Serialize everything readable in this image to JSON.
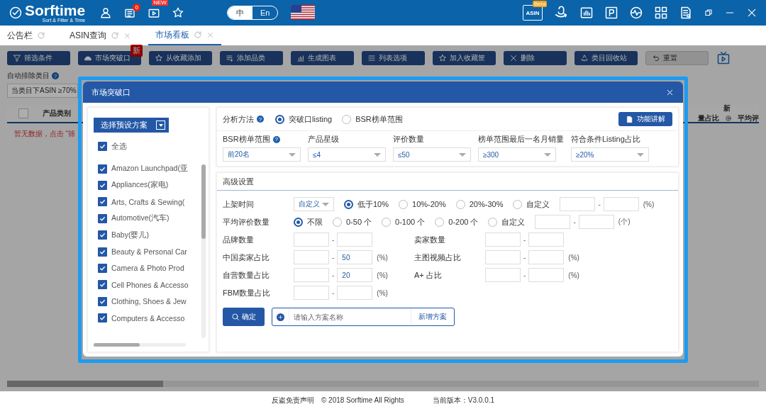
{
  "app": {
    "logo": "Sorftime",
    "tagline": "Sort & Filter & Time",
    "notice_count": "0",
    "video_badge": "NEW",
    "languages": [
      {
        "label": "中",
        "selected": true
      },
      {
        "label": "En",
        "selected": false
      }
    ],
    "asin_badge": "Beta",
    "asin_label": "ASIN"
  },
  "tabs": [
    {
      "label": "公告栏",
      "selected": false,
      "closable": false
    },
    {
      "label": "ASIN查询",
      "selected": false,
      "closable": true
    },
    {
      "label": "市场看板",
      "selected": true,
      "closable": true
    }
  ],
  "toolbar": [
    {
      "label": "筛选条件",
      "kind": "filter"
    },
    {
      "label": "市场突破口",
      "kind": "rocket",
      "badge": "新"
    },
    {
      "label": "从收藏添加",
      "kind": "star"
    },
    {
      "label": "添加品类",
      "kind": "addlist"
    },
    {
      "label": "生成图表",
      "kind": "chart"
    },
    {
      "label": "列表选项",
      "kind": "menu"
    },
    {
      "label": "加入收藏筐",
      "kind": "star"
    },
    {
      "label": "删除",
      "kind": "delete"
    },
    {
      "label": "类目回收站",
      "kind": "recycle"
    },
    {
      "label": "重置",
      "kind": "reset"
    }
  ],
  "exclude": {
    "label": "自动排除类目",
    "help": "?",
    "value": "当类目下ASIN ≥70%"
  },
  "table": {
    "select_all_checked": false,
    "column": "产品类别",
    "empty_message": "暂无数据，点击 “筛",
    "right_group": "新",
    "right_column": "量占比",
    "right_column_2": "平均评"
  },
  "modal": {
    "title": "市场突破口",
    "preset_button": "选择预设方案",
    "select_all": {
      "label": "全选",
      "checked": true
    },
    "categories": [
      {
        "label": "Amazon Launchpad(亚",
        "checked": true
      },
      {
        "label": "Appliances(家电)",
        "checked": true
      },
      {
        "label": "Arts, Crafts & Sewing(",
        "checked": true
      },
      {
        "label": "Automotive(汽车)",
        "checked": true
      },
      {
        "label": "Baby(婴儿)",
        "checked": true
      },
      {
        "label": "Beauty & Personal Car",
        "checked": true
      },
      {
        "label": "Camera & Photo Prod",
        "checked": true
      },
      {
        "label": "Cell Phones & Accesso",
        "checked": true
      },
      {
        "label": "Clothing, Shoes & Jew",
        "checked": true
      },
      {
        "label": "Computers & Accesso",
        "checked": true
      }
    ],
    "method": {
      "label": "分析方法",
      "help": "?",
      "options": [
        {
          "label": "突破口listing",
          "selected": true
        },
        {
          "label": "BSR榜单范围",
          "selected": false
        }
      ]
    },
    "help_button": "功能讲解",
    "dropdowns": [
      {
        "label": "BSR榜单范围",
        "help": "?",
        "value": "前20名"
      },
      {
        "label": "产品星级",
        "value": "≤4"
      },
      {
        "label": "评价数量",
        "value": "≤50"
      },
      {
        "label": "榜单范围最后一名月销量",
        "value": "≥300"
      },
      {
        "label": "符合条件Listing占比",
        "value": "≥20%"
      }
    ],
    "advanced": {
      "title": "高级设置",
      "listing_time": {
        "label": "上架时间",
        "dropdown": "自定义",
        "options": [
          {
            "label": "低于10%",
            "selected": true
          },
          {
            "label": "10%-20%",
            "selected": false
          },
          {
            "label": "20%-30%",
            "selected": false
          },
          {
            "label": "自定义",
            "selected": false
          }
        ],
        "separator": "-",
        "unit": "(%)"
      },
      "avg_reviews": {
        "label": "平均评价数量",
        "options": [
          {
            "label": "不限",
            "selected": true
          },
          {
            "label": "0-50 个",
            "selected": false
          },
          {
            "label": "0-100 个",
            "selected": false
          },
          {
            "label": "0-200 个",
            "selected": false
          },
          {
            "label": "自定义",
            "selected": false
          }
        ],
        "separator": "-",
        "unit": "(个)"
      },
      "ranges": [
        [
          {
            "label": "品牌数量",
            "separator": "-"
          },
          {
            "label": "卖家数量",
            "separator": "-"
          }
        ],
        [
          {
            "label": "中国卖家占比",
            "separator": "-",
            "max": "50",
            "unit": "(%)"
          },
          {
            "label": "主图视频占比",
            "separator": "-",
            "unit": "(%)"
          }
        ],
        [
          {
            "label": "自营数量占比",
            "separator": "-",
            "max": "20",
            "unit": "(%)"
          },
          {
            "label": "A+ 占比",
            "separator": "-",
            "unit": "(%)"
          }
        ],
        [
          {
            "label": "FBM数量占比",
            "separator": "-",
            "unit": "(%)"
          }
        ]
      ]
    },
    "confirm_button": "确定",
    "scheme_placeholder": "请输入方案名称",
    "add_scheme_button": "新增方案"
  },
  "footer": {
    "disclaimer": "反盗免责声明",
    "copyright": "© 2018 Sorftime All Rights",
    "version": "当前版本：V3.0.0.1"
  }
}
